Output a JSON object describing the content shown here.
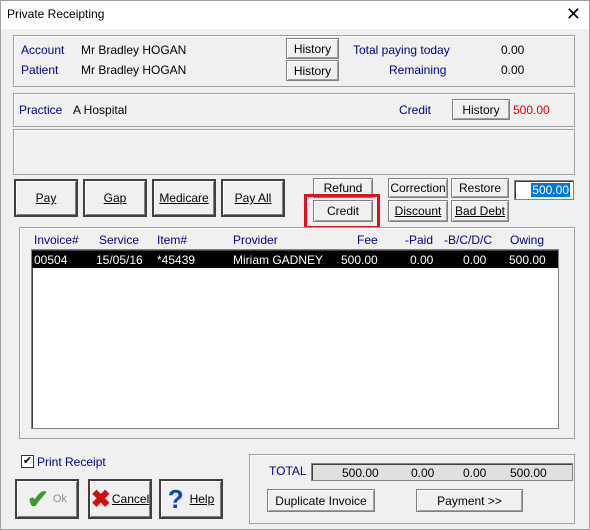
{
  "window": {
    "title": "Private Receipting",
    "close": "✕"
  },
  "account": {
    "account_label": "Account",
    "account_value": "Mr Bradley HOGAN",
    "patient_label": "Patient",
    "patient_value": "Mr Bradley HOGAN",
    "history_btn": "History",
    "total_paying_label": "Total paying today",
    "total_paying_value": "0.00",
    "remaining_label": "Remaining",
    "remaining_value": "0.00"
  },
  "practice": {
    "label": "Practice",
    "value": "A Hospital",
    "credit_label": "Credit",
    "history_btn": "History",
    "credit_value": "500.00"
  },
  "actions": {
    "pay": "Pay",
    "gap": "Gap",
    "medicare": "Medicare",
    "pay_all": "Pay All",
    "refund": "Refund",
    "credit": "Credit",
    "correction": "Correction",
    "restore": "Restore",
    "discount": "Discount",
    "bad_debt": "Bad Debt",
    "amount": "500.00"
  },
  "table": {
    "headers": [
      "Invoice#",
      "Service",
      "Item#",
      "Provider",
      "Fee",
      "-Paid",
      "-B/C/D/C",
      "Owing"
    ],
    "rows": [
      {
        "invoice": "00504",
        "service": "15/05/16",
        "item": "*45439",
        "provider": "Miriam GADNEY",
        "fee": "500.00",
        "paid": "0.00",
        "bcdc": "0.00",
        "owing": "500.00"
      }
    ]
  },
  "footer": {
    "print_receipt": "Print Receipt",
    "print_checked": "✔",
    "ok": "Ok",
    "cancel": "Cancel",
    "help": "Help",
    "total_label": "TOTAL",
    "total_fee": "500.00",
    "total_paid": "0.00",
    "total_bcdc": "0.00",
    "total_owing": "500.00",
    "duplicate_invoice": "Duplicate Invoice",
    "payment": "Payment >>"
  }
}
